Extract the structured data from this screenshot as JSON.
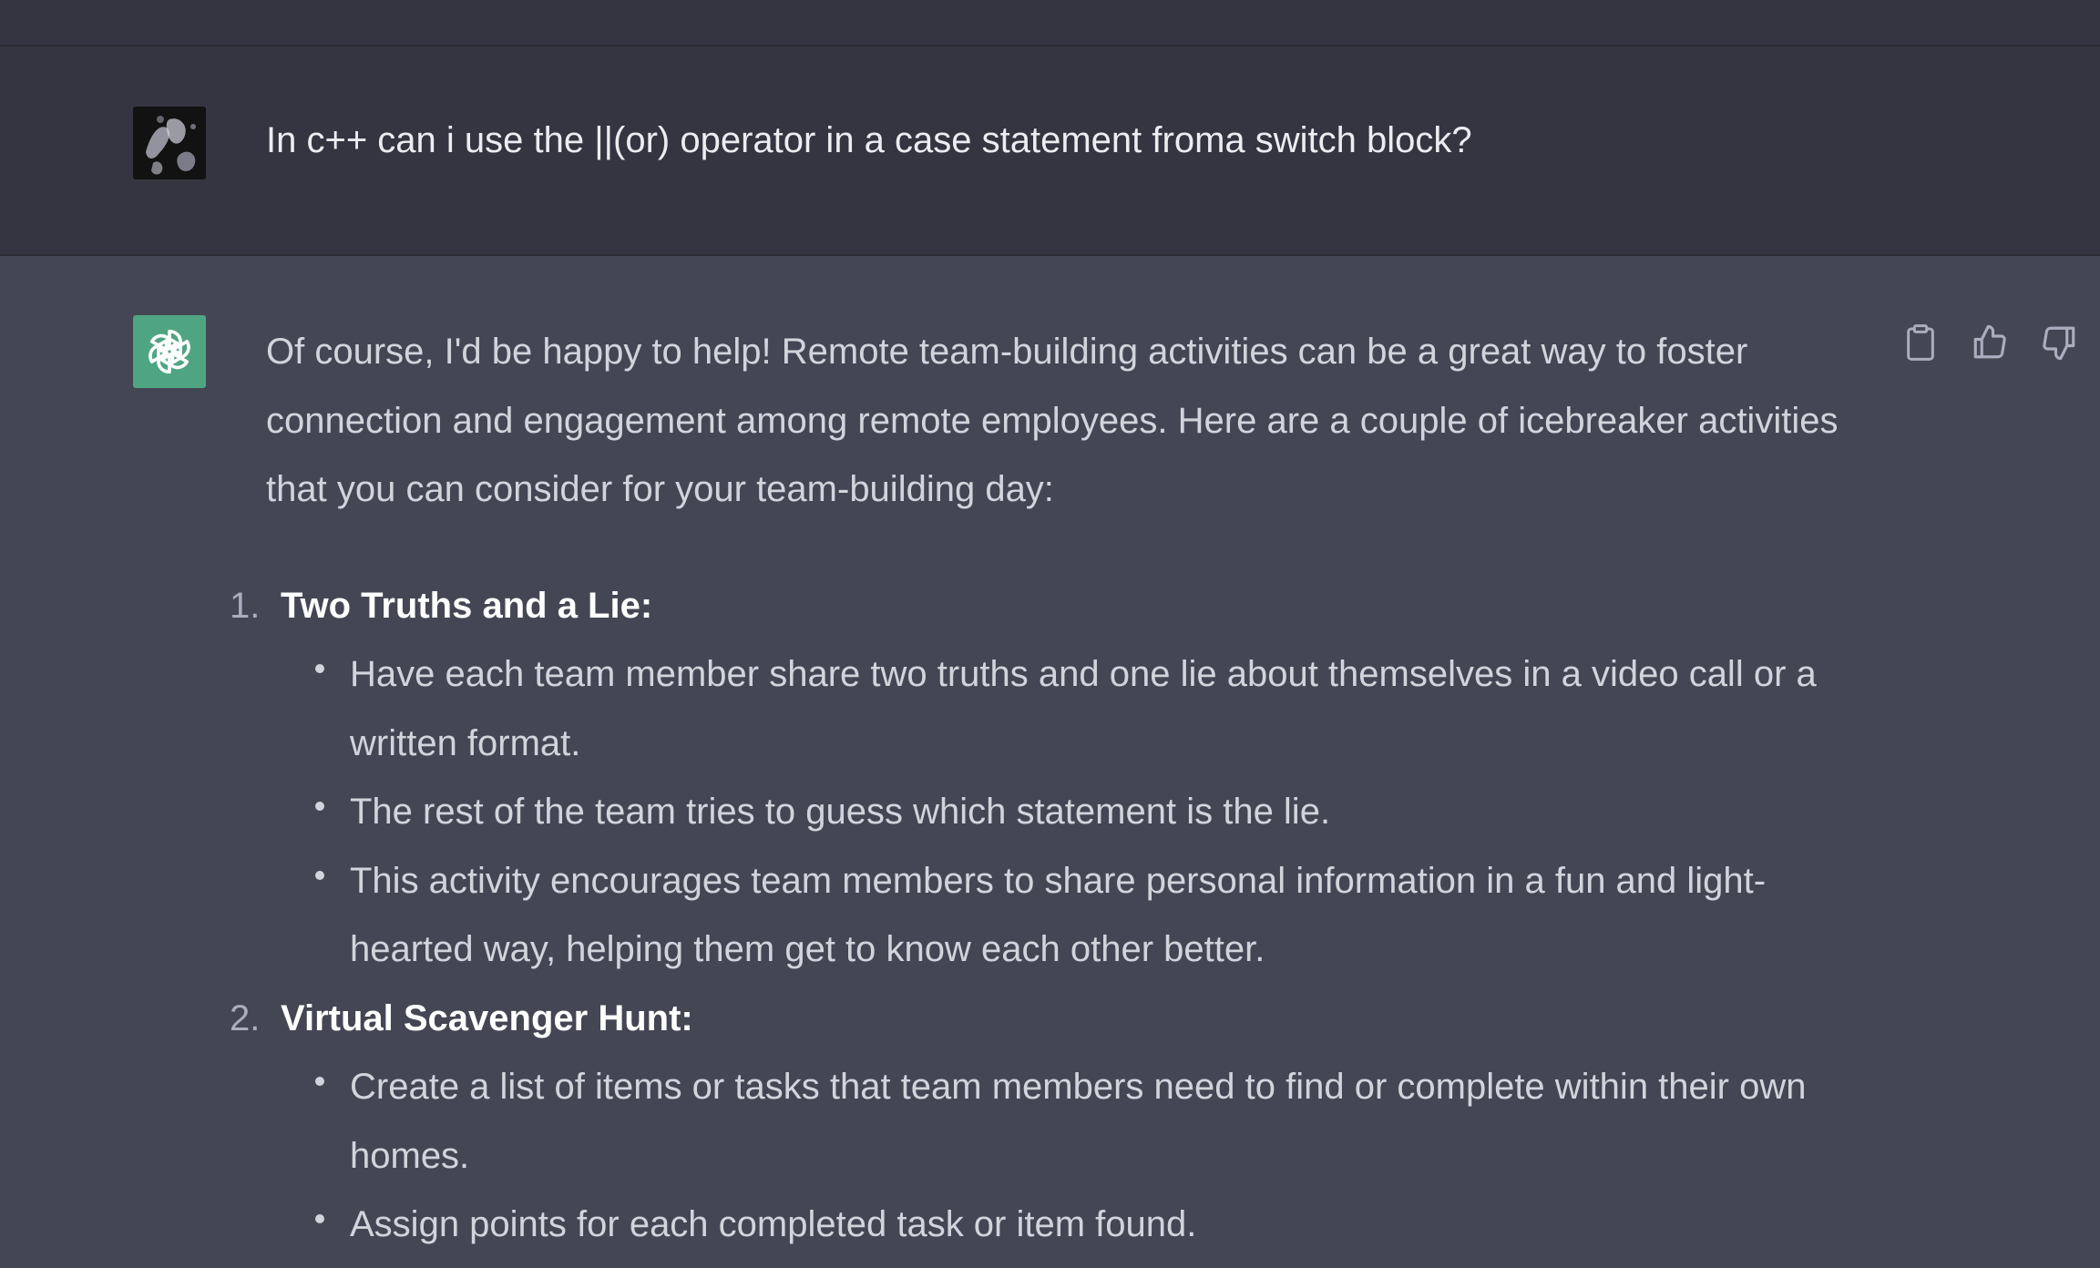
{
  "conversation": {
    "user_message": "In c++ can i use the ||(or) operator in a case statement froma switch block?",
    "assistant_intro": "Of course, I'd be happy to help! Remote team-building activities can be a great way to foster connection and engagement among remote employees. Here are a couple of icebreaker activities that you can consider for your team-building day:",
    "activities": [
      {
        "number": "1.",
        "title": "Two Truths and a Lie:",
        "bullets": [
          "Have each team member share two truths and one lie about themselves in a video call or a written format.",
          "The rest of the team tries to guess which statement is the lie.",
          "This activity encourages team members to share personal information in a fun and light-hearted way, helping them get to know each other better."
        ]
      },
      {
        "number": "2.",
        "title": "Virtual Scavenger Hunt:",
        "bullets": [
          "Create a list of items or tasks that team members need to find or complete within their own homes.",
          "Assign points for each completed task or item found."
        ]
      }
    ]
  },
  "icons": {
    "user_avatar": "user-avatar-image",
    "assistant_avatar": "openai-logo-icon",
    "copy": "clipboard-icon",
    "like": "thumbs-up-icon",
    "dislike": "thumbs-down-icon"
  },
  "colors": {
    "user_row_bg": "#343541",
    "assistant_row_bg": "#444654",
    "assistant_avatar_bg": "#4fa582",
    "text_primary": "#ececf1",
    "text_secondary": "#d1d5db"
  }
}
